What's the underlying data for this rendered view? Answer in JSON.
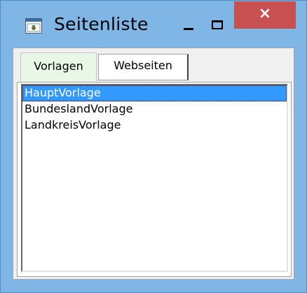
{
  "window": {
    "title": "Seitenliste",
    "icon": "app-window-icon",
    "buttons": {
      "minimize": "minimize-icon",
      "maximize": "maximize-icon",
      "close": "×"
    },
    "colors": {
      "titlebar": "#7fb6e6",
      "close": "#c75050",
      "selection": "#3399ff"
    }
  },
  "tabs": [
    {
      "label": "Vorlagen",
      "active": true
    },
    {
      "label": "Webseiten",
      "active": false
    }
  ],
  "list": {
    "items": [
      "HauptVorlage",
      "BundeslandVorlage",
      "LandkreisVorlage"
    ],
    "selected_index": 0
  }
}
